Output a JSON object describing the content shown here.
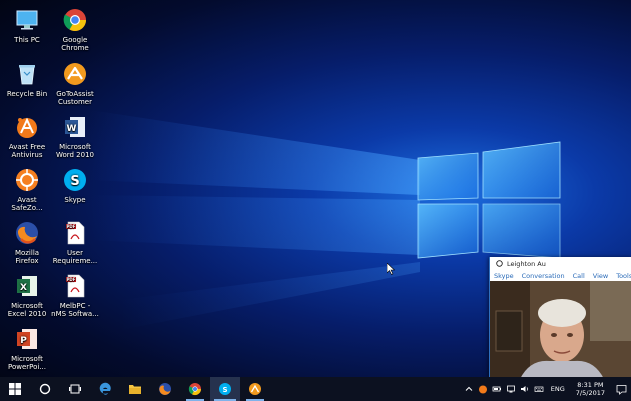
{
  "desktop": {
    "icons": [
      {
        "label": "This PC",
        "icon": "this-pc-icon"
      },
      {
        "label": "Google\nChrome",
        "icon": "chrome-icon"
      },
      {
        "label": "Recycle Bin",
        "icon": "recycle-bin-icon"
      },
      {
        "label": "GoToAssist\nCustomer",
        "icon": "gotoassist-icon"
      },
      {
        "label": "Avast Free\nAntivirus",
        "icon": "avast-icon"
      },
      {
        "label": "Microsoft\nWord 2010",
        "icon": "word-icon"
      },
      {
        "label": "Avast\nSafeZo...",
        "icon": "avast-safezone-icon"
      },
      {
        "label": "Skype",
        "icon": "skype-icon"
      },
      {
        "label": "Mozilla\nFirefox",
        "icon": "firefox-icon"
      },
      {
        "label": "User\nRequireme...",
        "icon": "pdf-icon"
      },
      {
        "label": "Microsoft\nExcel 2010",
        "icon": "excel-icon"
      },
      {
        "label": "MelbPC -\nnMS Softwa...",
        "icon": "pdf-icon"
      },
      {
        "label": "Microsoft\nPowerPoi...",
        "icon": "powerpoint-icon"
      }
    ]
  },
  "skype_window": {
    "title": "Leighton Au",
    "menu": [
      "Skype",
      "Conversation",
      "Call",
      "View",
      "Tools"
    ]
  },
  "taskbar": {
    "buttons": [
      "start-icon",
      "cortana-icon",
      "task-view-icon",
      "edge-icon",
      "file-explorer-icon",
      "firefox-icon",
      "chrome-icon",
      "skype-icon",
      "gotoassist-icon"
    ],
    "language": "ENG",
    "time": "8:31 PM",
    "date": "7/5/2017"
  },
  "colors": {
    "taskbar": "#0c1120",
    "accent": "#7fb2ea",
    "skype_blue": "#00aff0"
  }
}
